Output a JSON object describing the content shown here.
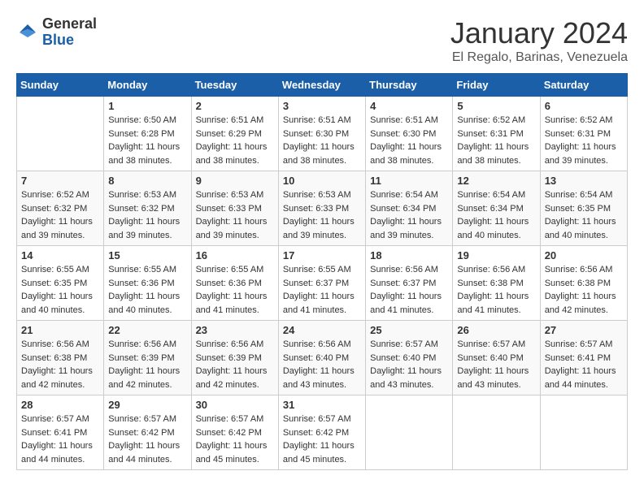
{
  "header": {
    "logo_general": "General",
    "logo_blue": "Blue",
    "month_title": "January 2024",
    "location": "El Regalo, Barinas, Venezuela"
  },
  "weekdays": [
    "Sunday",
    "Monday",
    "Tuesday",
    "Wednesday",
    "Thursday",
    "Friday",
    "Saturday"
  ],
  "weeks": [
    [
      {
        "day": "",
        "sunrise": "",
        "sunset": "",
        "daylight": ""
      },
      {
        "day": "1",
        "sunrise": "Sunrise: 6:50 AM",
        "sunset": "Sunset: 6:28 PM",
        "daylight": "Daylight: 11 hours and 38 minutes."
      },
      {
        "day": "2",
        "sunrise": "Sunrise: 6:51 AM",
        "sunset": "Sunset: 6:29 PM",
        "daylight": "Daylight: 11 hours and 38 minutes."
      },
      {
        "day": "3",
        "sunrise": "Sunrise: 6:51 AM",
        "sunset": "Sunset: 6:30 PM",
        "daylight": "Daylight: 11 hours and 38 minutes."
      },
      {
        "day": "4",
        "sunrise": "Sunrise: 6:51 AM",
        "sunset": "Sunset: 6:30 PM",
        "daylight": "Daylight: 11 hours and 38 minutes."
      },
      {
        "day": "5",
        "sunrise": "Sunrise: 6:52 AM",
        "sunset": "Sunset: 6:31 PM",
        "daylight": "Daylight: 11 hours and 38 minutes."
      },
      {
        "day": "6",
        "sunrise": "Sunrise: 6:52 AM",
        "sunset": "Sunset: 6:31 PM",
        "daylight": "Daylight: 11 hours and 39 minutes."
      }
    ],
    [
      {
        "day": "7",
        "sunrise": "Sunrise: 6:52 AM",
        "sunset": "Sunset: 6:32 PM",
        "daylight": "Daylight: 11 hours and 39 minutes."
      },
      {
        "day": "8",
        "sunrise": "Sunrise: 6:53 AM",
        "sunset": "Sunset: 6:32 PM",
        "daylight": "Daylight: 11 hours and 39 minutes."
      },
      {
        "day": "9",
        "sunrise": "Sunrise: 6:53 AM",
        "sunset": "Sunset: 6:33 PM",
        "daylight": "Daylight: 11 hours and 39 minutes."
      },
      {
        "day": "10",
        "sunrise": "Sunrise: 6:53 AM",
        "sunset": "Sunset: 6:33 PM",
        "daylight": "Daylight: 11 hours and 39 minutes."
      },
      {
        "day": "11",
        "sunrise": "Sunrise: 6:54 AM",
        "sunset": "Sunset: 6:34 PM",
        "daylight": "Daylight: 11 hours and 39 minutes."
      },
      {
        "day": "12",
        "sunrise": "Sunrise: 6:54 AM",
        "sunset": "Sunset: 6:34 PM",
        "daylight": "Daylight: 11 hours and 40 minutes."
      },
      {
        "day": "13",
        "sunrise": "Sunrise: 6:54 AM",
        "sunset": "Sunset: 6:35 PM",
        "daylight": "Daylight: 11 hours and 40 minutes."
      }
    ],
    [
      {
        "day": "14",
        "sunrise": "Sunrise: 6:55 AM",
        "sunset": "Sunset: 6:35 PM",
        "daylight": "Daylight: 11 hours and 40 minutes."
      },
      {
        "day": "15",
        "sunrise": "Sunrise: 6:55 AM",
        "sunset": "Sunset: 6:36 PM",
        "daylight": "Daylight: 11 hours and 40 minutes."
      },
      {
        "day": "16",
        "sunrise": "Sunrise: 6:55 AM",
        "sunset": "Sunset: 6:36 PM",
        "daylight": "Daylight: 11 hours and 41 minutes."
      },
      {
        "day": "17",
        "sunrise": "Sunrise: 6:55 AM",
        "sunset": "Sunset: 6:37 PM",
        "daylight": "Daylight: 11 hours and 41 minutes."
      },
      {
        "day": "18",
        "sunrise": "Sunrise: 6:56 AM",
        "sunset": "Sunset: 6:37 PM",
        "daylight": "Daylight: 11 hours and 41 minutes."
      },
      {
        "day": "19",
        "sunrise": "Sunrise: 6:56 AM",
        "sunset": "Sunset: 6:38 PM",
        "daylight": "Daylight: 11 hours and 41 minutes."
      },
      {
        "day": "20",
        "sunrise": "Sunrise: 6:56 AM",
        "sunset": "Sunset: 6:38 PM",
        "daylight": "Daylight: 11 hours and 42 minutes."
      }
    ],
    [
      {
        "day": "21",
        "sunrise": "Sunrise: 6:56 AM",
        "sunset": "Sunset: 6:38 PM",
        "daylight": "Daylight: 11 hours and 42 minutes."
      },
      {
        "day": "22",
        "sunrise": "Sunrise: 6:56 AM",
        "sunset": "Sunset: 6:39 PM",
        "daylight": "Daylight: 11 hours and 42 minutes."
      },
      {
        "day": "23",
        "sunrise": "Sunrise: 6:56 AM",
        "sunset": "Sunset: 6:39 PM",
        "daylight": "Daylight: 11 hours and 42 minutes."
      },
      {
        "day": "24",
        "sunrise": "Sunrise: 6:56 AM",
        "sunset": "Sunset: 6:40 PM",
        "daylight": "Daylight: 11 hours and 43 minutes."
      },
      {
        "day": "25",
        "sunrise": "Sunrise: 6:57 AM",
        "sunset": "Sunset: 6:40 PM",
        "daylight": "Daylight: 11 hours and 43 minutes."
      },
      {
        "day": "26",
        "sunrise": "Sunrise: 6:57 AM",
        "sunset": "Sunset: 6:40 PM",
        "daylight": "Daylight: 11 hours and 43 minutes."
      },
      {
        "day": "27",
        "sunrise": "Sunrise: 6:57 AM",
        "sunset": "Sunset: 6:41 PM",
        "daylight": "Daylight: 11 hours and 44 minutes."
      }
    ],
    [
      {
        "day": "28",
        "sunrise": "Sunrise: 6:57 AM",
        "sunset": "Sunset: 6:41 PM",
        "daylight": "Daylight: 11 hours and 44 minutes."
      },
      {
        "day": "29",
        "sunrise": "Sunrise: 6:57 AM",
        "sunset": "Sunset: 6:42 PM",
        "daylight": "Daylight: 11 hours and 44 minutes."
      },
      {
        "day": "30",
        "sunrise": "Sunrise: 6:57 AM",
        "sunset": "Sunset: 6:42 PM",
        "daylight": "Daylight: 11 hours and 45 minutes."
      },
      {
        "day": "31",
        "sunrise": "Sunrise: 6:57 AM",
        "sunset": "Sunset: 6:42 PM",
        "daylight": "Daylight: 11 hours and 45 minutes."
      },
      {
        "day": "",
        "sunrise": "",
        "sunset": "",
        "daylight": ""
      },
      {
        "day": "",
        "sunrise": "",
        "sunset": "",
        "daylight": ""
      },
      {
        "day": "",
        "sunrise": "",
        "sunset": "",
        "daylight": ""
      }
    ]
  ]
}
